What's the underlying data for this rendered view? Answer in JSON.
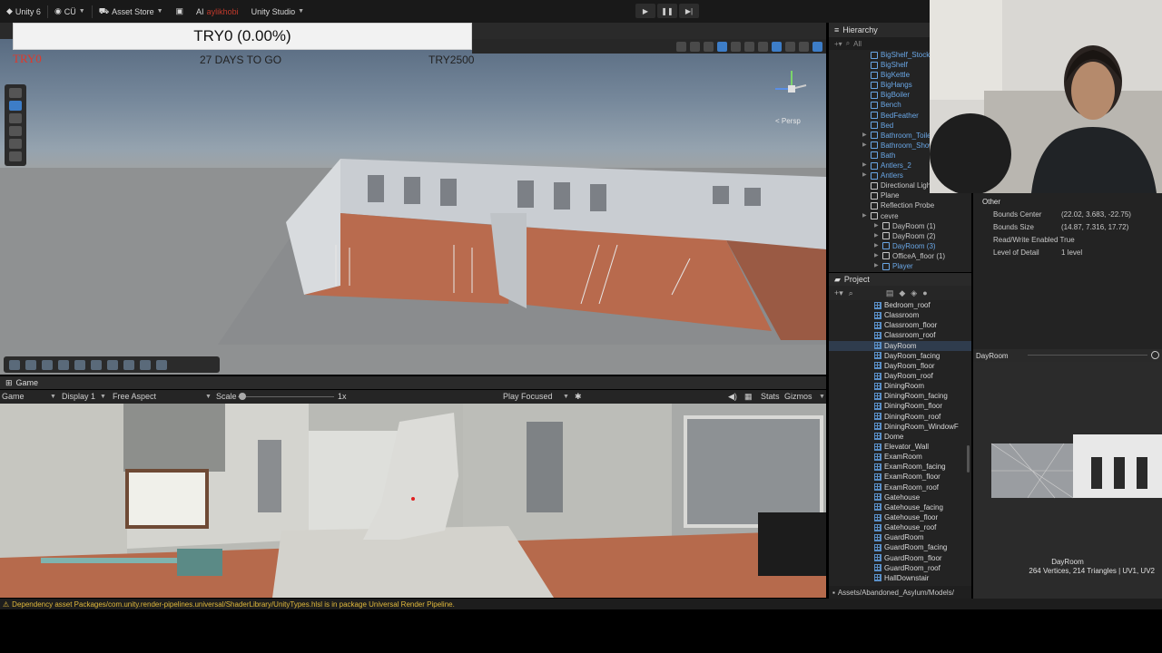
{
  "topbar": {
    "unity_label": "Unity 6",
    "account_label": "CÜ",
    "asset_store_label": "Asset Store",
    "ai_label": "AI",
    "overlay_text": "aylikhobi",
    "unity_studio_label": "Unity Studio"
  },
  "hud": {
    "progress_text": "TRY0 (0.00%)",
    "try_label": "TRY0",
    "days_to_go": "27 DAYS TO GO",
    "try_2500": "TRY2500"
  },
  "scene": {
    "persp_label": "< Persp"
  },
  "game": {
    "tab_label": "Game",
    "mode_label": "Game",
    "display_label": "Display 1",
    "aspect_label": "Free Aspect",
    "scale_label": "Scale",
    "scale_value": "1x",
    "play_focused_label": "Play Focused",
    "stats_label": "Stats",
    "gizmos_label": "Gizmos"
  },
  "hierarchy": {
    "title": "Hierarchy",
    "search_placeholder": "All",
    "items": [
      {
        "label": "BigShelf_Stock",
        "blue": true,
        "expand": false
      },
      {
        "label": "BigShelf",
        "blue": true,
        "expand": false
      },
      {
        "label": "BigKettle",
        "blue": true,
        "expand": false
      },
      {
        "label": "BigHangs",
        "blue": true,
        "expand": false
      },
      {
        "label": "BigBoiler",
        "blue": true,
        "expand": false
      },
      {
        "label": "Bench",
        "blue": true,
        "expand": false
      },
      {
        "label": "BedFeather",
        "blue": true,
        "expand": false
      },
      {
        "label": "Bed",
        "blue": true,
        "expand": false
      },
      {
        "label": "Bathroom_Toile",
        "blue": true,
        "expand": true
      },
      {
        "label": "Bathroom_Show",
        "blue": true,
        "expand": true
      },
      {
        "label": "Bath",
        "blue": true,
        "expand": false
      },
      {
        "label": "Antlers_2",
        "blue": true,
        "expand": true
      },
      {
        "label": "Antlers",
        "blue": true,
        "expand": true
      },
      {
        "label": "Directional Ligh",
        "blue": false,
        "expand": false
      },
      {
        "label": "Plane",
        "blue": false,
        "expand": false
      },
      {
        "label": "Reflection Probe",
        "blue": false,
        "expand": false
      },
      {
        "label": "cevre",
        "blue": false,
        "expand": true
      },
      {
        "label": "DayRoom (1)",
        "blue": false,
        "expand": true
      },
      {
        "label": "DayRoom (2)",
        "blue": false,
        "expand": true
      },
      {
        "label": "DayRoom (3)",
        "blue": true,
        "expand": true
      },
      {
        "label": "OfficeA_floor (1)",
        "blue": false,
        "expand": true
      },
      {
        "label": "Player",
        "blue": true,
        "expand": true
      }
    ]
  },
  "project": {
    "title": "Project",
    "files": [
      "Bedroom_roof",
      "Classroom",
      "Classroom_floor",
      "Classroom_roof",
      "DayRoom",
      "DayRoom_facing",
      "DayRoom_floor",
      "DayRoom_roof",
      "DiningRoom",
      "DiningRoom_facing",
      "DiningRoom_floor",
      "DiningRoom_roof",
      "DiningRoom_WindowF",
      "Dome",
      "Elevator_Wall",
      "ExamRoom",
      "ExamRoom_facing",
      "ExamRoom_floor",
      "ExamRoom_roof",
      "Gatehouse",
      "Gatehouse_facing",
      "Gatehouse_floor",
      "Gatehouse_roof",
      "GuardRoom",
      "GuardRoom_facing",
      "GuardRoom_floor",
      "GuardRoom_roof",
      "HallDownstair"
    ],
    "selected_index": 4,
    "path": "Assets/Abandoned_Asylum/Models/"
  },
  "inspector": {
    "section": "Other",
    "bounds_center_label": "Bounds Center",
    "bounds_center_value": "(22.02, 3.683, -22.75)",
    "bounds_size_label": "Bounds Size",
    "bounds_size_value": "(14.87, 7.316, 17.72)",
    "rw_label": "Read/Write Enabled",
    "rw_value": "True",
    "lod_label": "Level of Detail",
    "lod_value": "1 level",
    "preview_title": "DayRoom",
    "preview_name": "DayRoom",
    "preview_stats": "264 Vertices, 214 Triangles | UV1, UV2"
  },
  "status": {
    "message": "Dependency asset Packages/com.unity.render-pipelines.universal/ShaderLibrary/UnityTypes.hlsl is in package Universal Render Pipeline."
  }
}
